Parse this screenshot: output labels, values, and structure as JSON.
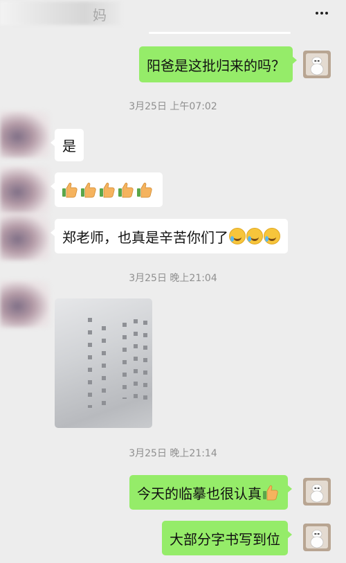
{
  "header": {
    "title": "妈"
  },
  "messages": {
    "m1": "阳爸是这批归来的吗？",
    "ts1": "3月25日 上午07:02",
    "m2": "是",
    "m4": "郑老师，也真是辛苦你们了",
    "ts2": "3月25日 晚上21:04",
    "ts3": "3月25日 晚上21:14",
    "m5": "今天的临摹也很认真",
    "m6": "大部分字书写到位"
  },
  "icons": {
    "more": "more-dots-icon",
    "thumbs": "thumbs-up-emoji",
    "laugh": "laughing-tears-emoji",
    "self_avatar": "white-robot-avatar"
  },
  "colors": {
    "background": "#ededed",
    "self_bubble": "#95ec69",
    "other_bubble": "#ffffff",
    "timestamp": "#8f8f8f"
  }
}
